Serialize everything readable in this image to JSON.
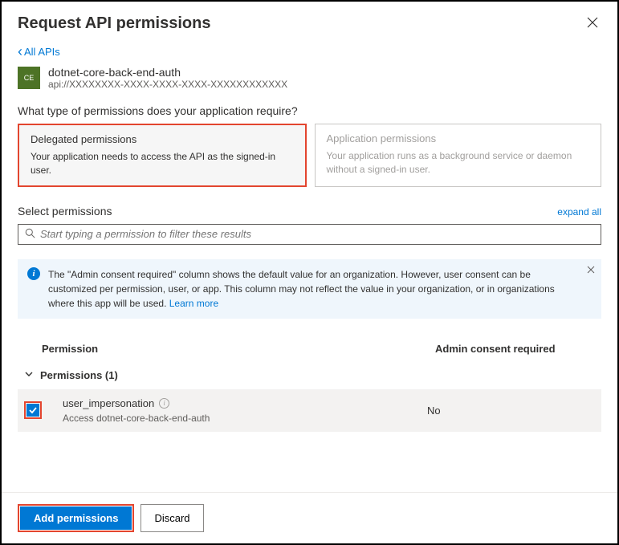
{
  "header": {
    "title": "Request API permissions"
  },
  "back": {
    "label": "All APIs"
  },
  "api": {
    "icon_text": "CE",
    "name": "dotnet-core-back-end-auth",
    "uri": "api://XXXXXXXX-XXXX-XXXX-XXXX-XXXXXXXXXXXX"
  },
  "question": "What type of permissions does your application require?",
  "perm_types": {
    "delegated": {
      "title": "Delegated permissions",
      "desc": "Your application needs to access the API as the signed-in user."
    },
    "application": {
      "title": "Application permissions",
      "desc": "Your application runs as a background service or daemon without a signed-in user."
    }
  },
  "select": {
    "label": "Select permissions",
    "expand": "expand all"
  },
  "search": {
    "placeholder": "Start typing a permission to filter these results"
  },
  "info": {
    "text": "The \"Admin consent required\" column shows the default value for an organization. However, user consent can be customized per permission, user, or app. This column may not reflect the value in your organization, or in organizations where this app will be used. ",
    "learn_more": "Learn more"
  },
  "table": {
    "col_permission": "Permission",
    "col_admin": "Admin consent required",
    "group_label": "Permissions (1)",
    "rows": [
      {
        "name": "user_impersonation",
        "desc": "Access dotnet-core-back-end-auth",
        "admin": "No",
        "checked": true
      }
    ]
  },
  "footer": {
    "add": "Add permissions",
    "discard": "Discard"
  }
}
